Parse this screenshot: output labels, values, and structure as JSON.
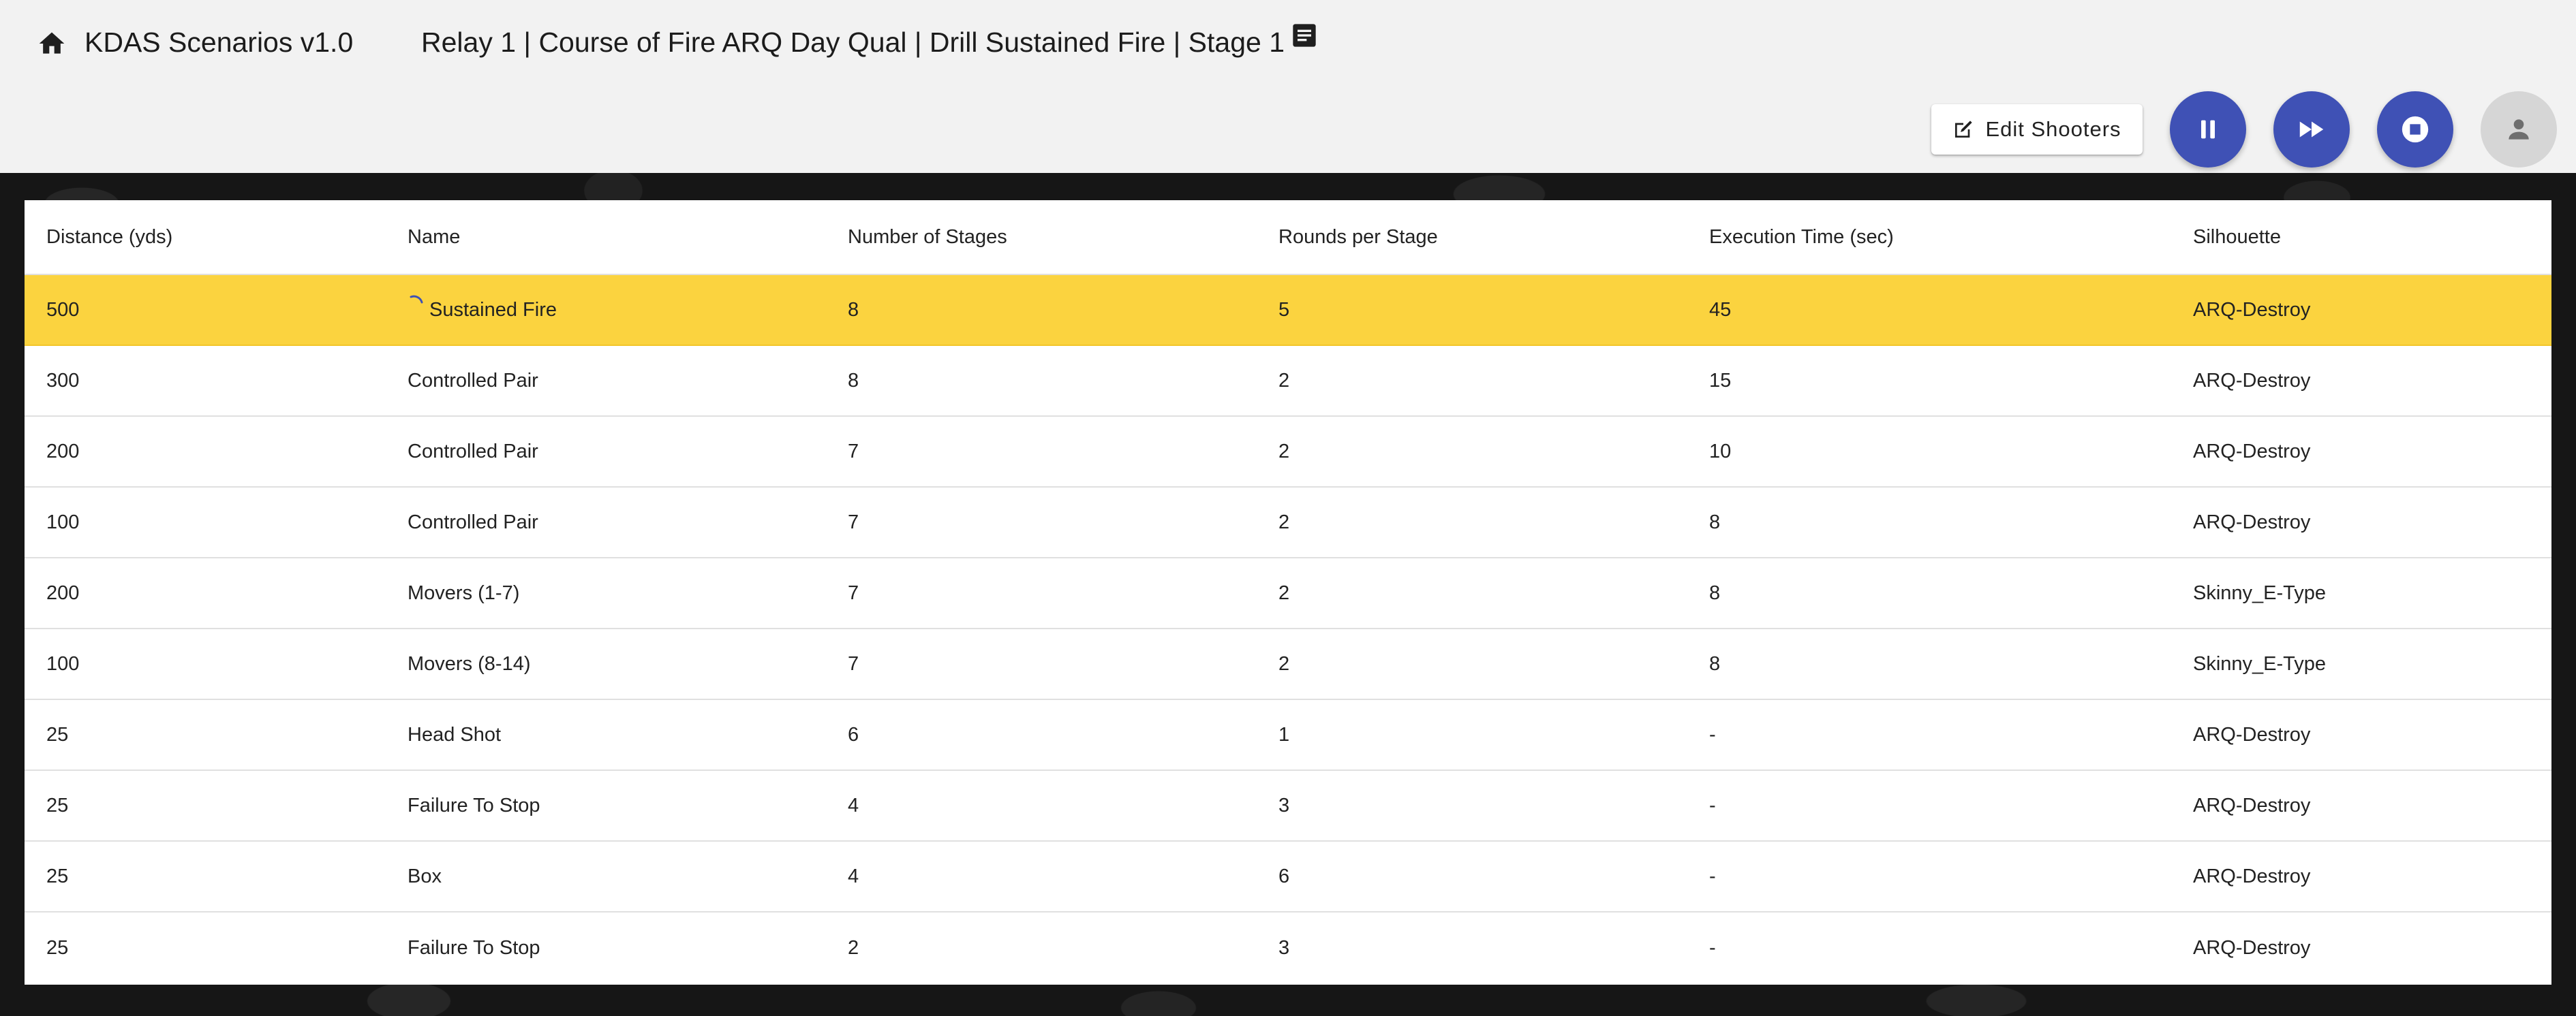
{
  "app": {
    "title": "KDAS Scenarios v1.0",
    "breadcrumb": "Relay 1 | Course of Fire ARQ Day Qual | Drill Sustained Fire | Stage 1"
  },
  "toolbar": {
    "edit_shooters_label": "Edit Shooters",
    "icons": {
      "home": "home-icon",
      "notes": "notes-icon",
      "edit": "edit-icon",
      "pause": "pause-icon",
      "skip": "fast-forward-icon",
      "stop": "stop-icon",
      "user": "person-icon"
    }
  },
  "colors": {
    "accent": "#3f51b5",
    "active_row": "#fbd33f",
    "header_bg": "#f2f2f2"
  },
  "table": {
    "columns": [
      "Distance (yds)",
      "Name",
      "Number of Stages",
      "Rounds per Stage",
      "Execution Time (sec)",
      "Silhouette"
    ],
    "rows": [
      {
        "distance": "500",
        "name": "Sustained Fire",
        "stages": "8",
        "rounds": "5",
        "time": "45",
        "silhouette": "ARQ-Destroy"
      },
      {
        "distance": "300",
        "name": "Controlled Pair",
        "stages": "8",
        "rounds": "2",
        "time": "15",
        "silhouette": "ARQ-Destroy"
      },
      {
        "distance": "200",
        "name": "Controlled Pair",
        "stages": "7",
        "rounds": "2",
        "time": "10",
        "silhouette": "ARQ-Destroy"
      },
      {
        "distance": "100",
        "name": "Controlled Pair",
        "stages": "7",
        "rounds": "2",
        "time": "8",
        "silhouette": "ARQ-Destroy"
      },
      {
        "distance": "200",
        "name": "Movers (1-7)",
        "stages": "7",
        "rounds": "2",
        "time": "8",
        "silhouette": "Skinny_E-Type"
      },
      {
        "distance": "100",
        "name": "Movers (8-14)",
        "stages": "7",
        "rounds": "2",
        "time": "8",
        "silhouette": "Skinny_E-Type"
      },
      {
        "distance": "25",
        "name": "Head Shot",
        "stages": "6",
        "rounds": "1",
        "time": "-",
        "silhouette": "ARQ-Destroy"
      },
      {
        "distance": "25",
        "name": "Failure To Stop",
        "stages": "4",
        "rounds": "3",
        "time": "-",
        "silhouette": "ARQ-Destroy"
      },
      {
        "distance": "25",
        "name": "Box",
        "stages": "4",
        "rounds": "6",
        "time": "-",
        "silhouette": "ARQ-Destroy"
      },
      {
        "distance": "25",
        "name": "Failure To Stop",
        "stages": "2",
        "rounds": "3",
        "time": "-",
        "silhouette": "ARQ-Destroy"
      }
    ]
  }
}
